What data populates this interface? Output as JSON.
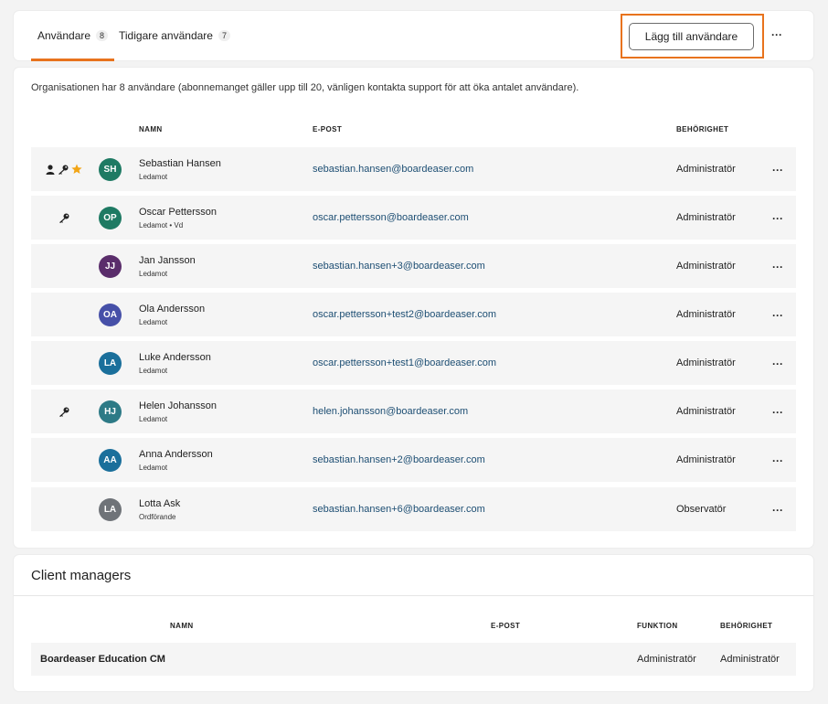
{
  "tabs": {
    "users": {
      "label": "Användare",
      "count": "8"
    },
    "previous": {
      "label": "Tidigare användare",
      "count": "7"
    },
    "add_button": "Lägg till användare",
    "more": "···"
  },
  "users_section": {
    "info": "Organisationen har 8 användare (abonnemanget gäller upp till 20, vänligen kontakta support för att öka antalet användare).",
    "headers": {
      "name": "NAMN",
      "email": "E-POST",
      "permission": "BEHÖRIGHET"
    },
    "rows": [
      {
        "initials": "SH",
        "name": "Sebastian Hansen",
        "role": "Ledamot",
        "email": "sebastian.hansen@boardeaser.com",
        "permission": "Administratör",
        "icons": [
          "person-icon",
          "key-icon",
          "star-icon"
        ],
        "avatar_color": "#1e7a63",
        "more": "···"
      },
      {
        "initials": "OP",
        "name": "Oscar Pettersson",
        "role": "Ledamot • Vd",
        "email": "oscar.pettersson@boardeaser.com",
        "permission": "Administratör",
        "icons": [
          "key-icon"
        ],
        "avatar_color": "#1e7a63",
        "more": "···"
      },
      {
        "initials": "JJ",
        "name": "Jan Jansson",
        "role": "Ledamot",
        "email": "sebastian.hansen+3@boardeaser.com",
        "permission": "Administratör",
        "icons": [],
        "avatar_color": "#5a2d6b",
        "more": "···"
      },
      {
        "initials": "OA",
        "name": "Ola Andersson",
        "role": "Ledamot",
        "email": "oscar.pettersson+test2@boardeaser.com",
        "permission": "Administratör",
        "icons": [],
        "avatar_color": "#4650a8",
        "more": "···"
      },
      {
        "initials": "LA",
        "name": "Luke Andersson",
        "role": "Ledamot",
        "email": "oscar.pettersson+test1@boardeaser.com",
        "permission": "Administratör",
        "icons": [],
        "avatar_color": "#1a6f9b",
        "more": "···"
      },
      {
        "initials": "HJ",
        "name": "Helen Johansson",
        "role": "Ledamot",
        "email": "helen.johansson@boardeaser.com",
        "permission": "Administratör",
        "icons": [
          "key-icon"
        ],
        "avatar_color": "#2d7a86",
        "more": "···"
      },
      {
        "initials": "AA",
        "name": "Anna Andersson",
        "role": "Ledamot",
        "email": "sebastian.hansen+2@boardeaser.com",
        "permission": "Administratör",
        "icons": [],
        "avatar_color": "#1a6f9b",
        "more": "···"
      },
      {
        "initials": "LA",
        "name": "Lotta Ask",
        "role": "Ordförande",
        "email": "sebastian.hansen+6@boardeaser.com",
        "permission": "Observatör",
        "icons": [],
        "avatar_color": "#6f7378",
        "more": "···"
      }
    ]
  },
  "client_managers": {
    "title": "Client managers",
    "headers": {
      "name": "NAMN",
      "email": "E-POST",
      "function": "FUNKTION",
      "permission": "BEHÖRIGHET"
    },
    "rows": [
      {
        "name": "Boardeaser Education CM",
        "email": "",
        "function": "Administratör",
        "permission": "Administratör"
      }
    ]
  },
  "colors": {
    "accent": "#e8731d",
    "link": "#1d4e73",
    "star": "#f2a516",
    "row_bg": "#f5f5f5"
  }
}
